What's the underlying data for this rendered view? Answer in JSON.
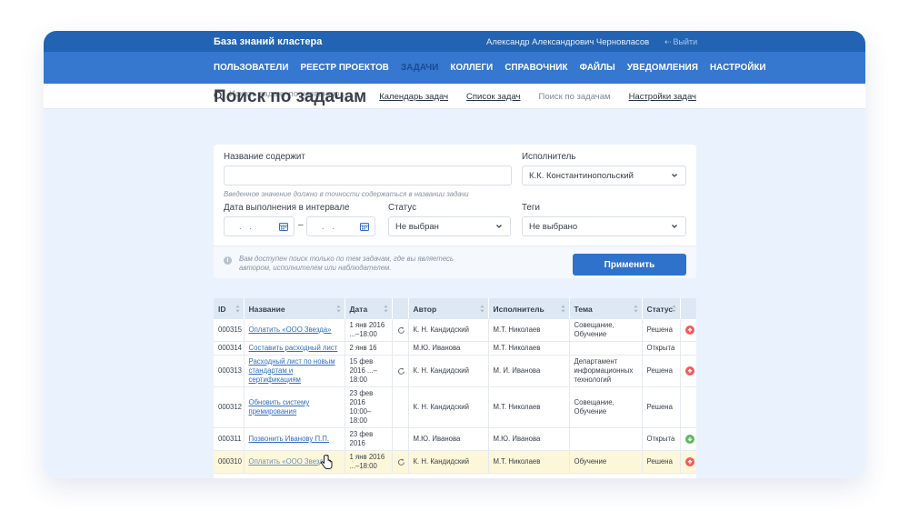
{
  "header": {
    "app_title": "База знаний кластера",
    "user_name": "Александр Александрович Черновласов",
    "logout_label": "Выйти"
  },
  "nav": {
    "items": [
      {
        "label": "ПОЛЬЗОВАТЕЛИ",
        "active": false
      },
      {
        "label": "РЕЕСТР ПРОЕКТОВ",
        "active": false
      },
      {
        "label": "ЗАДАЧИ",
        "active": true
      },
      {
        "label": "КОЛЛЕГИ",
        "active": false
      },
      {
        "label": "СПРАВОЧНИК",
        "active": false
      },
      {
        "label": "ФАЙЛЫ",
        "active": false
      },
      {
        "label": "УВЕДОМЛЕНИЯ",
        "active": false
      },
      {
        "label": "НАСТРОЙКИ",
        "active": false
      }
    ]
  },
  "subnav": {
    "search_placeholder": "Искать задачу по названию…",
    "links": [
      "Календарь задач",
      "Список задач",
      "Поиск по задачам",
      "Настройки задач"
    ],
    "current": "Поиск по задачам"
  },
  "page": {
    "title": "Поиск по задачам"
  },
  "filters": {
    "name_label": "Название содержит",
    "name_value": "",
    "name_hint": "Введенное значение должно в точности содержаться в названии задачи",
    "assignee_label": "Исполнитель",
    "assignee_value": "К.К. Константинопольский",
    "date_label": "Дата выполнения в интервале",
    "date_from": ".   .",
    "date_to": ".   .",
    "date_dash": "–",
    "status_label": "Статус",
    "status_value": "Не выбран",
    "tags_label": "Теги",
    "tags_value": "Не выбрано",
    "info_text": "Вам доступен поиск только по тем задачам, где вы являетесь автором, исполнителем или наблюдателем.",
    "apply_label": "Применить"
  },
  "table": {
    "columns": [
      "ID",
      "Название",
      "Дата",
      "",
      "Автор",
      "Исполнитель",
      "Тема",
      "Статус",
      ""
    ],
    "rows": [
      {
        "id": "000315",
        "name": "Оплатить «ООО Звезда»",
        "date": "1 янв 2016 ...–18:00",
        "recurring": true,
        "author": "К. Н. Кандидский",
        "assignee": "М.Т. Николаев",
        "topic": "Совещание, Обучение",
        "status": "Решена",
        "mark": "up"
      },
      {
        "id": "000314",
        "name": "Составить расходный лист",
        "date": "2 янв 16",
        "recurring": false,
        "author": "М.Ю. Иванова",
        "assignee": "М.Т. Николаев",
        "topic": "",
        "status": "Открыта",
        "mark": ""
      },
      {
        "id": "000313",
        "name": "Расходный лист по новым стандартам и сертификациям",
        "date": "15 фев 2016 ...–18:00",
        "recurring": true,
        "author": "К. Н. Кандидский",
        "assignee": "М. И. Иванова",
        "topic": "Департамент информационных технологий",
        "status": "Решена",
        "mark": "up"
      },
      {
        "id": "000312",
        "name": "Обновить систему премирования",
        "date": "23 фев 2016 10:00–18:00",
        "recurring": false,
        "author": "К. Н. Кандидский",
        "assignee": "М.Т. Николаев",
        "topic": "Совещание, Обучение",
        "status": "Решена",
        "mark": ""
      },
      {
        "id": "000311",
        "name": "Позвонить Иванову П.П.",
        "date": "23 фев 2016",
        "recurring": false,
        "author": "М.Ю. Иванова",
        "assignee": "М.Ю. Иванова",
        "topic": "",
        "status": "Открыта",
        "mark": "down"
      },
      {
        "id": "000310",
        "name": "Оплатить «ООО Звезда»",
        "date": "1 янв 2016 ...–18:00",
        "recurring": true,
        "author": "К. Н. Кандидский",
        "assignee": "М.Т. Николаев",
        "topic": "Обучение",
        "status": "Решена",
        "mark": "up",
        "highlight": true
      }
    ]
  },
  "colors": {
    "topbar": "#2363b3",
    "navbar": "#3677cf",
    "accent_button": "#2f72cc",
    "page_bg": "#eaf3fd",
    "up_mark": "#ef5b5b",
    "down_mark": "#5cb85c"
  },
  "icons": {
    "search": "search-icon",
    "calendar": "calendar-icon",
    "chevron": "chevron-down-icon",
    "info": "info-icon",
    "refresh": "refresh-icon",
    "sort": "sort-icon",
    "logout": "logout-icon",
    "cursor": "hand-cursor-icon"
  }
}
